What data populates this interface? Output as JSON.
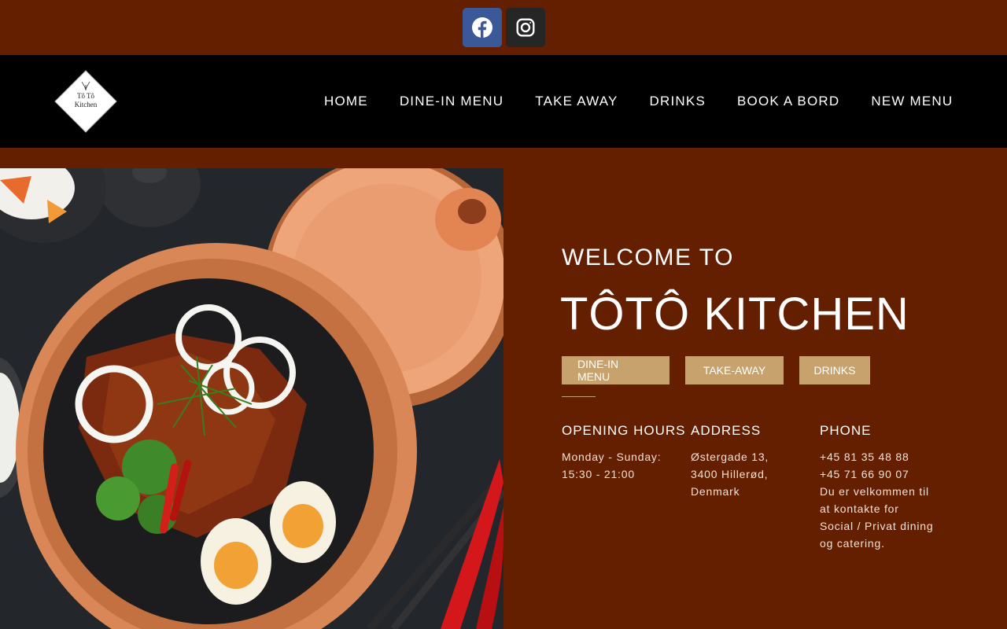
{
  "social": {
    "facebook_icon": "facebook-icon",
    "instagram_icon": "instagram-icon",
    "facebook_color": "#3b5998",
    "instagram_color": "#262626"
  },
  "logo": {
    "line1": "Tô Tô",
    "line2": "Kitchen"
  },
  "nav": {
    "items": [
      {
        "label": "HOME"
      },
      {
        "label": "DINE-IN MENU"
      },
      {
        "label": "TAKE AWAY"
      },
      {
        "label": "DRINKS"
      },
      {
        "label": "BOOK A BORD"
      },
      {
        "label": "NEW MENU"
      }
    ]
  },
  "hero": {
    "welcome": "WELCOME TO",
    "title": "TÔTÔ KITCHEN",
    "buttons": [
      {
        "label": "DINE-IN MENU"
      },
      {
        "label": "TAKE-AWAY"
      },
      {
        "label": "DRINKS"
      }
    ]
  },
  "info": {
    "hours": {
      "heading": "OPENING HOURS",
      "lines": [
        "Monday - Sunday:",
        "15:30 - 21:00"
      ]
    },
    "address": {
      "heading": "ADDRESS",
      "lines": [
        "Østergade 13,",
        "3400 Hillerød,",
        "Denmark"
      ]
    },
    "phone": {
      "heading": "PHONE",
      "lines": [
        "+45 81 35 48 88",
        "+45 71 66 90 07",
        "Du er velkommen til",
        "at kontakte for",
        "Social / Privat dining",
        "og catering."
      ]
    }
  },
  "colors": {
    "background": "#641e00",
    "header": "#000000",
    "accent": "#c7a26d"
  }
}
